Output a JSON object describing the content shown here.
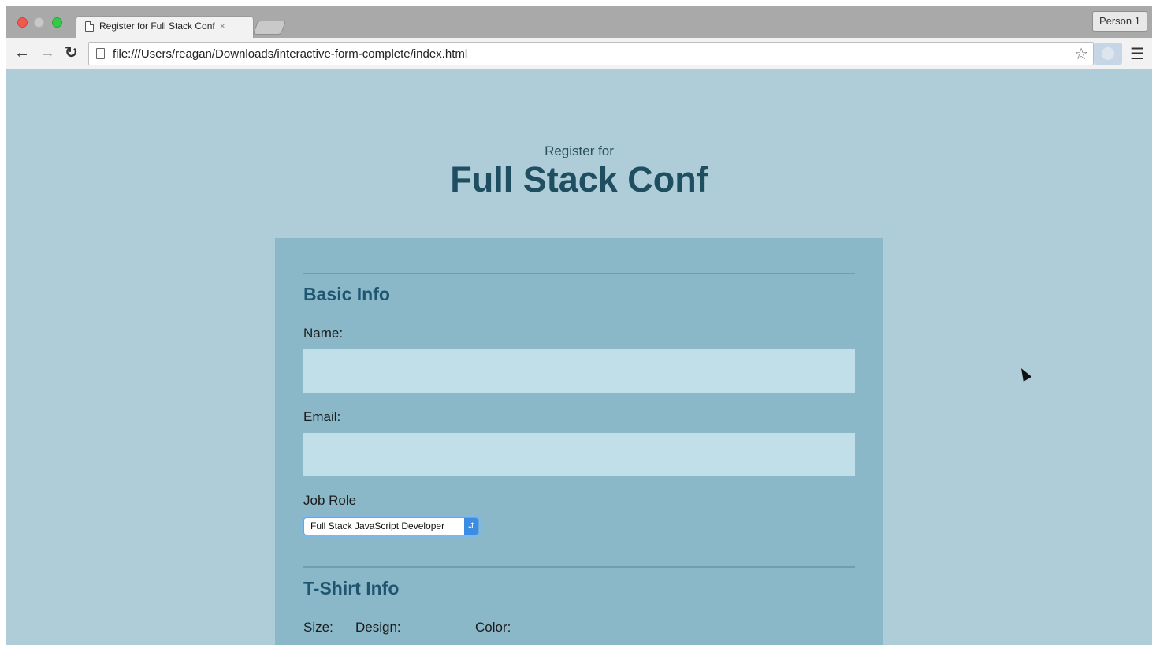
{
  "browser": {
    "tab_title": "Register for Full Stack Conf",
    "tab_close": "×",
    "profile_label": "Person 1",
    "url": "file:///Users/reagan/Downloads/interactive-form-complete/index.html"
  },
  "header": {
    "subtitle": "Register for",
    "title": "Full Stack Conf"
  },
  "form": {
    "basic_info": {
      "title": "Basic Info",
      "name_label": "Name:",
      "name_value": "",
      "email_label": "Email:",
      "email_value": "",
      "job_role_label": "Job Role",
      "job_role_selected": "Full Stack JavaScript Developer"
    },
    "tshirt_info": {
      "title": "T-Shirt Info",
      "size_label": "Size:",
      "design_label": "Design:",
      "color_label": "Color:"
    }
  },
  "colors": {
    "page_bg": "#aecdd8",
    "form_bg": "#8ab8c8",
    "title": "#1f4e60",
    "input_bg": "#c1dfe8"
  }
}
